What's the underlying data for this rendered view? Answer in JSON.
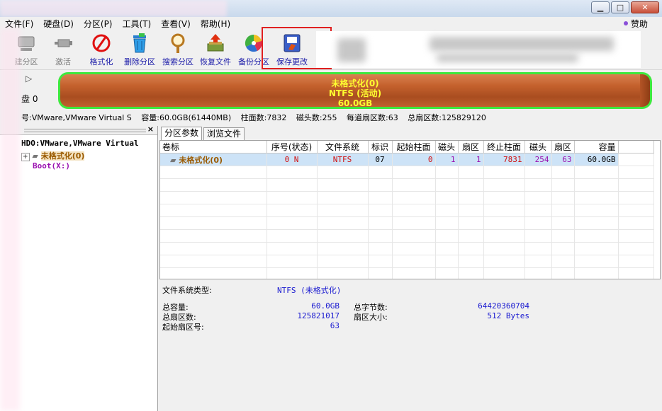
{
  "window": {
    "min": "▁",
    "max": "□",
    "close": "✕"
  },
  "menu": [
    "文件(F)",
    "硬盘(D)",
    "分区(P)",
    "工具(T)",
    "查看(V)",
    "帮助(H)"
  ],
  "help": "赞助",
  "toolbar": {
    "buttons": [
      {
        "label": "建分区",
        "icon": "new-partition-icon",
        "disabled": true
      },
      {
        "label": "激活",
        "icon": "activate-icon",
        "disabled": true
      },
      {
        "label": "格式化",
        "icon": "format-icon",
        "disabled": false
      },
      {
        "label": "删除分区",
        "icon": "trash-icon",
        "disabled": false
      },
      {
        "label": "搜索分区",
        "icon": "magnifier-icon",
        "disabled": false
      },
      {
        "label": "恢复文件",
        "icon": "restore-icon",
        "disabled": false
      },
      {
        "label": "备份分区",
        "icon": "backup-icon",
        "disabled": false
      },
      {
        "label": "保存更改",
        "icon": "save-icon",
        "disabled": false
      }
    ]
  },
  "disk": {
    "label": "盘 0",
    "part_name": "未格式化(0)",
    "part_fs": "NTFS (活动)",
    "part_size": "60.0GB",
    "bar_color": "#c4612d",
    "highlight_color": "#3ee83e"
  },
  "info": {
    "model": "号:VMware,VMware Virtual S",
    "capacity": "容量:60.0GB(61440MB)",
    "cylinders": "柱面数:7832",
    "heads": "磁头数:255",
    "sectors_per_track": "每道扇区数:63",
    "total_sectors": "总扇区数:125829120"
  },
  "tree": {
    "disk": "HDO:VMware,VMware Virtual",
    "partition": "未格式化(0)",
    "boot": "Boot(X:)"
  },
  "tabs": [
    "分区参数",
    "浏览文件"
  ],
  "table": {
    "headers": [
      "卷标",
      "序号(状态)",
      "文件系统",
      "标识",
      "起始柱面",
      "磁头",
      "扇区",
      "终止柱面",
      "磁头",
      "扇区",
      "容量"
    ],
    "rows": [
      [
        "未格式化(0)",
        "0 N",
        "NTFS",
        "07",
        "0",
        "1",
        "1",
        "7831",
        "254",
        "63",
        "60.0GB"
      ]
    ]
  },
  "details": {
    "fs_type_label": "文件系统类型:",
    "fs_type_value": "NTFS (未格式化)",
    "total_capacity_label": "总容量:",
    "total_capacity_value": "60.0GB",
    "total_bytes_label": "总字节数:",
    "total_bytes_value": "64420360704",
    "total_sectors_label": "总扇区数:",
    "total_sectors_value": "125821017",
    "sector_size_label": "扇区大小:",
    "sector_size_value": "512 Bytes",
    "start_sector_label": "起始扇区号:",
    "start_sector_value": "63"
  }
}
